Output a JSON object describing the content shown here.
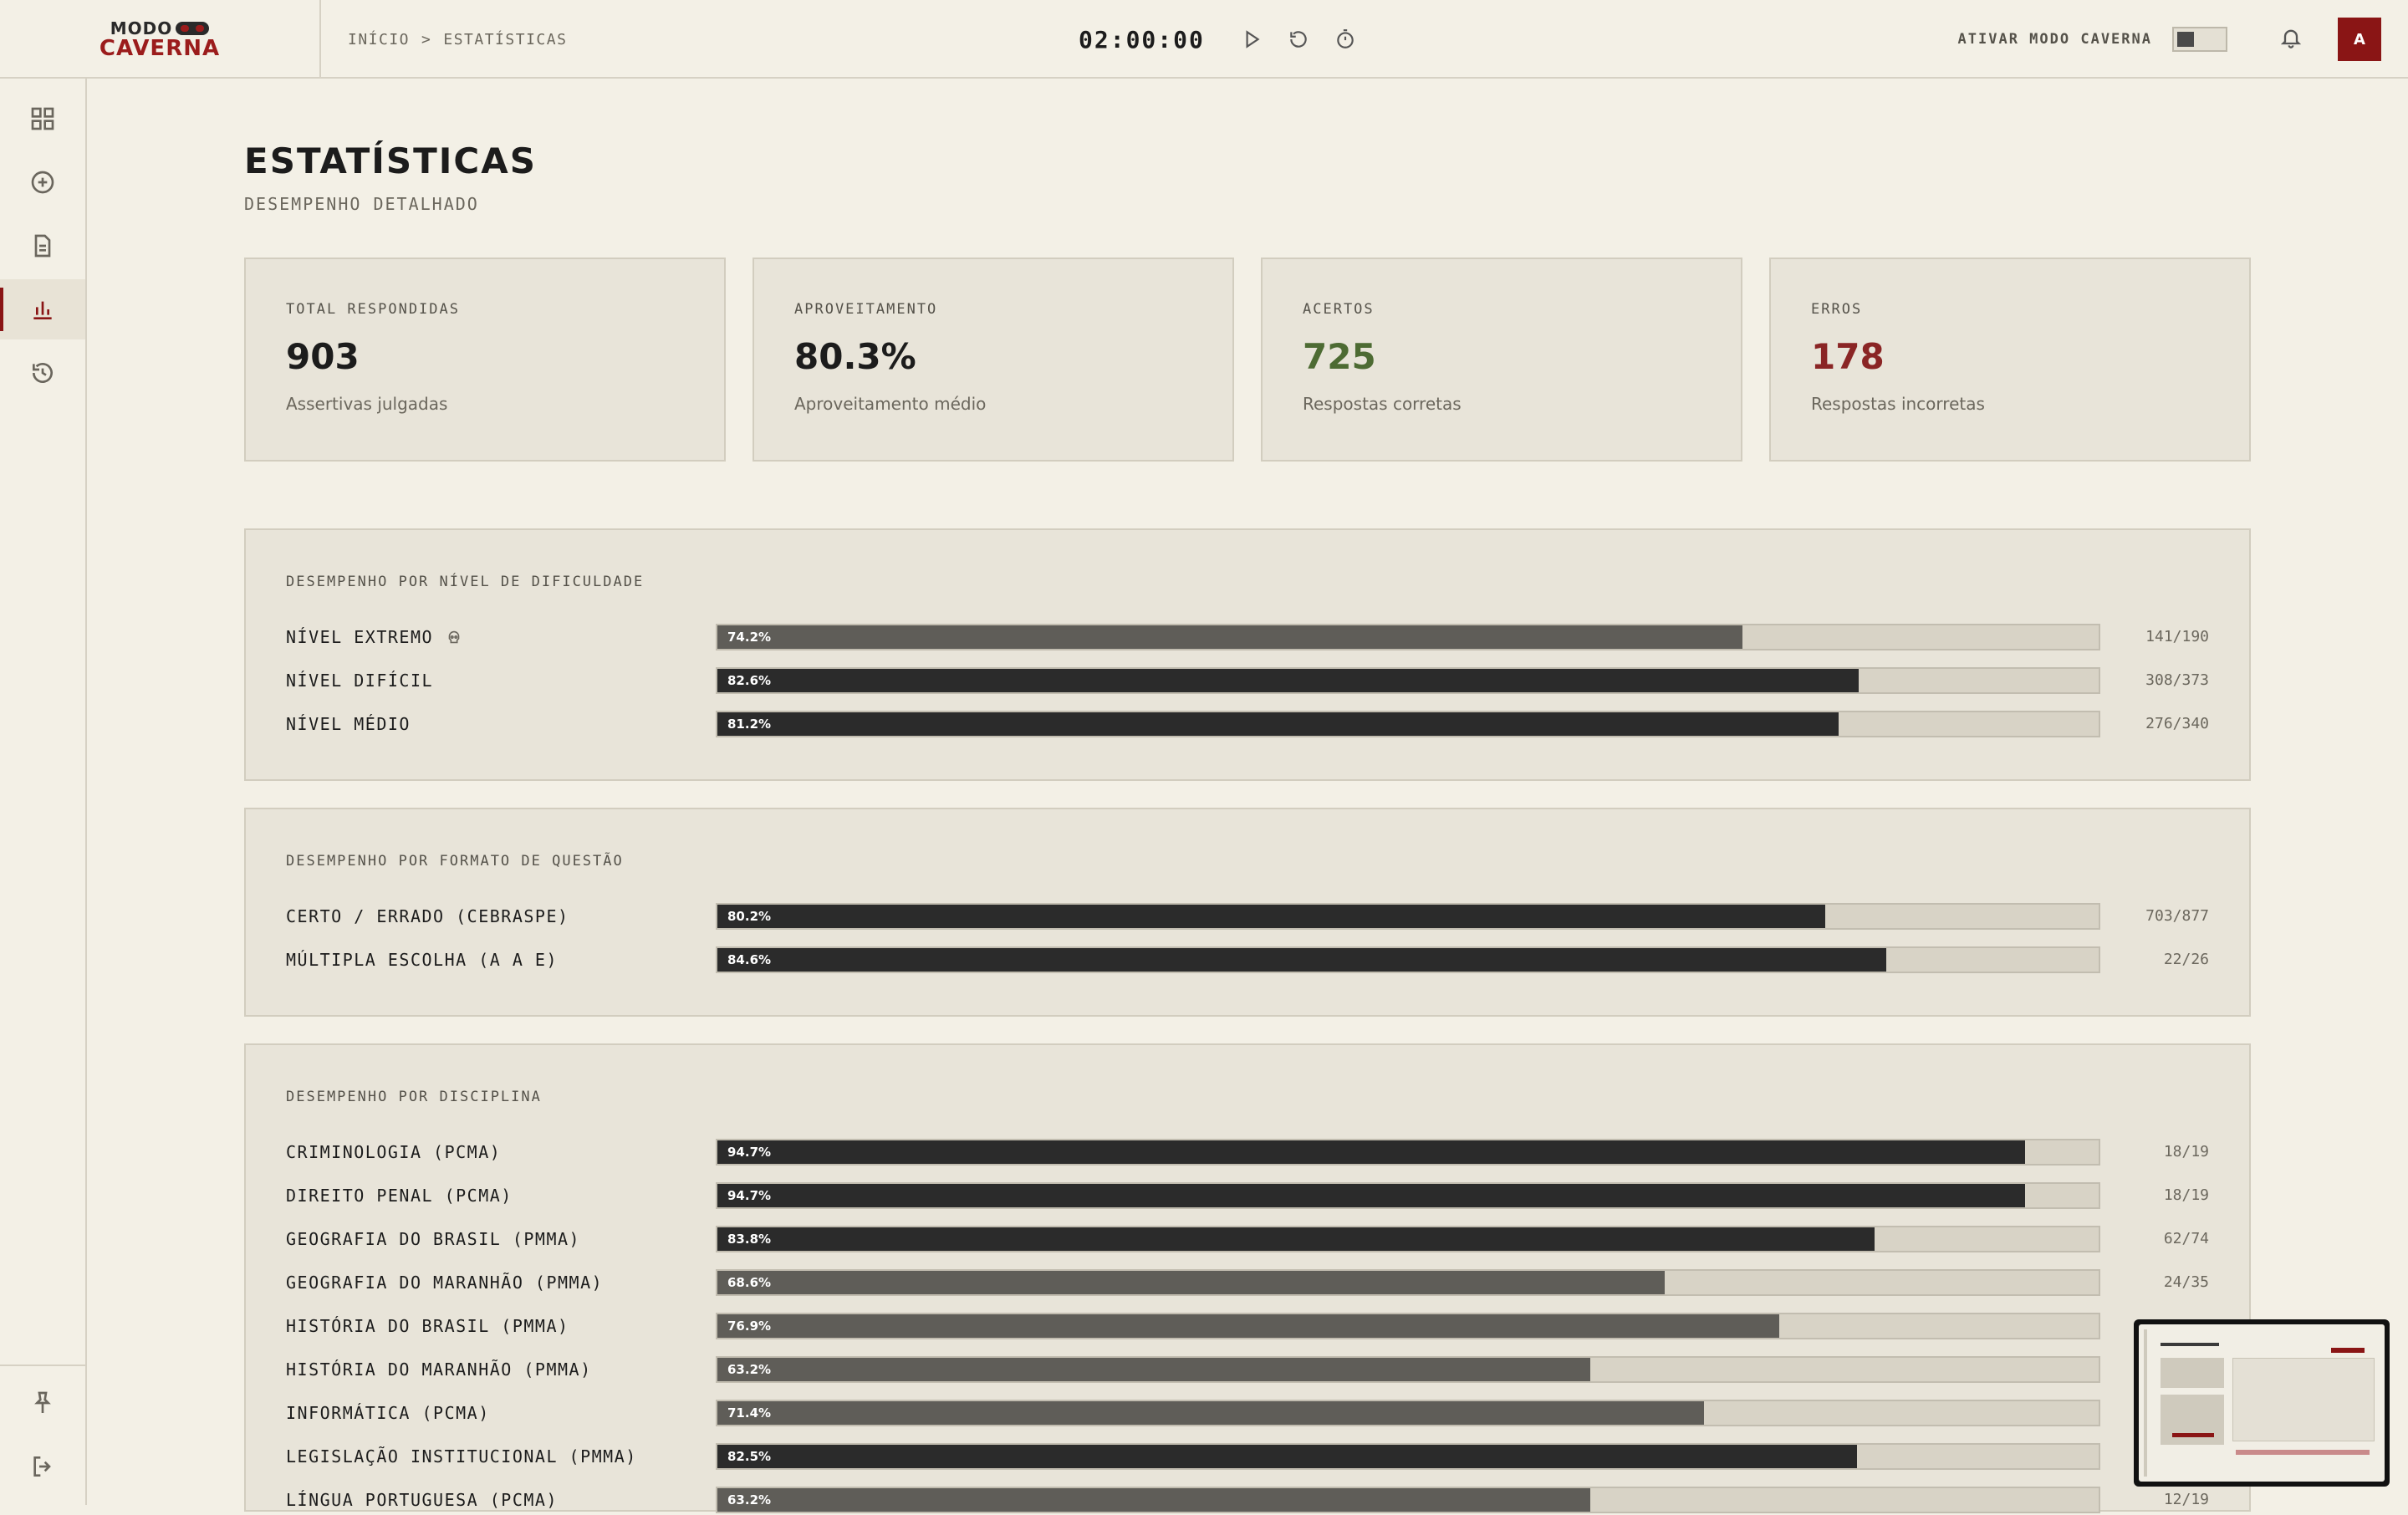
{
  "brand": {
    "top": "MODO",
    "bottom": "CAVERNA"
  },
  "breadcrumb": {
    "home": "INÍCIO",
    "separator": ">",
    "current": "ESTATÍSTICAS"
  },
  "timer": {
    "value": "02:00:00"
  },
  "cave_mode": {
    "label": "ATIVAR MODO CAVERNA",
    "enabled": false
  },
  "user": {
    "initial": "A"
  },
  "page": {
    "title": "ESTATÍSTICAS",
    "subtitle": "DESEMPENHO DETALHADO"
  },
  "cards": [
    {
      "label": "TOTAL RESPONDIDAS",
      "value": "903",
      "desc": "Assertivas julgadas"
    },
    {
      "label": "APROVEITAMENTO",
      "value": "80.3%",
      "desc": "Aproveitamento médio"
    },
    {
      "label": "ACERTOS",
      "value": "725",
      "desc": "Respostas corretas"
    },
    {
      "label": "ERROS",
      "value": "178",
      "desc": "Respostas incorretas"
    }
  ],
  "difficulty": {
    "title": "DESEMPENHO POR NÍVEL DE DIFICULDADE",
    "rows": [
      {
        "label": "NÍVEL EXTREMO",
        "pct": "74.2%",
        "fraction": 0.742,
        "count": "141/190"
      },
      {
        "label": "NÍVEL DIFÍCIL",
        "pct": "82.6%",
        "fraction": 0.826,
        "count": "308/373"
      },
      {
        "label": "NÍVEL MÉDIO",
        "pct": "81.2%",
        "fraction": 0.812,
        "count": "276/340"
      }
    ]
  },
  "format": {
    "title": "DESEMPENHO POR FORMATO DE QUESTÃO",
    "rows": [
      {
        "label": "CERTO / ERRADO (CEBRASPE)",
        "pct": "80.2%",
        "fraction": 0.802,
        "count": "703/877"
      },
      {
        "label": "MÚLTIPLA ESCOLHA (A A E)",
        "pct": "84.6%",
        "fraction": 0.846,
        "count": "22/26"
      }
    ]
  },
  "discipline": {
    "title": "DESEMPENHO POR DISCIPLINA",
    "rows": [
      {
        "label": "CRIMINOLOGIA (PCMA)",
        "pct": "94.7%",
        "fraction": 0.947,
        "count": "18/19"
      },
      {
        "label": "DIREITO PENAL (PCMA)",
        "pct": "94.7%",
        "fraction": 0.947,
        "count": "18/19"
      },
      {
        "label": "GEOGRAFIA DO BRASIL (PMMA)",
        "pct": "83.8%",
        "fraction": 0.838,
        "count": "62/74"
      },
      {
        "label": "GEOGRAFIA DO MARANHÃO (PMMA)",
        "pct": "68.6%",
        "fraction": 0.686,
        "count": "24/35"
      },
      {
        "label": "HISTÓRIA DO BRASIL (PMMA)",
        "pct": "76.9%",
        "fraction": 0.769,
        "count": ""
      },
      {
        "label": "HISTÓRIA DO MARANHÃO (PMMA)",
        "pct": "63.2%",
        "fraction": 0.632,
        "count": ""
      },
      {
        "label": "INFORMÁTICA (PCMA)",
        "pct": "71.4%",
        "fraction": 0.714,
        "count": ""
      },
      {
        "label": "LEGISLAÇÃO INSTITUCIONAL (PMMA)",
        "pct": "82.5%",
        "fraction": 0.825,
        "count": ""
      },
      {
        "label": "LÍNGUA PORTUGUESA (PCMA)",
        "pct": "63.2%",
        "fraction": 0.632,
        "count": "12/19"
      }
    ]
  }
}
